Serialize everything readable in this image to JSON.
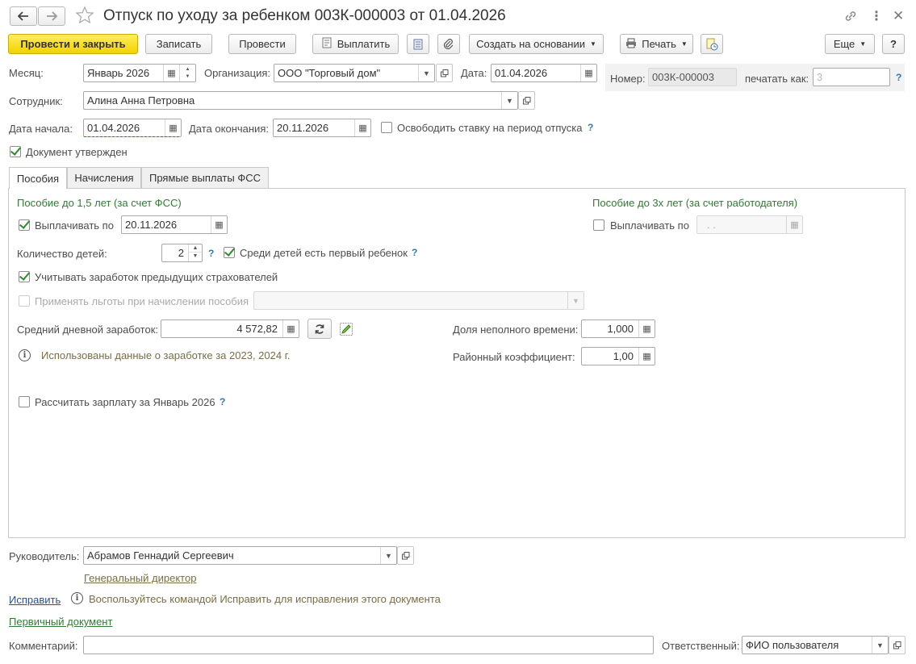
{
  "title": "Отпуск по уходу за ребенком 003К-000003 от 01.04.2026",
  "toolbar": {
    "post_close": "Провести и закрыть",
    "save": "Записать",
    "post": "Провести",
    "pay": "Выплатить",
    "create_based": "Создать на основании",
    "print": "Печать",
    "more": "Еще",
    "help": "?"
  },
  "header": {
    "month_label": "Месяц:",
    "month_value": "Январь 2026",
    "org_label": "Организация:",
    "org_value": "ООО \"Торговый дом\"",
    "date_label": "Дата:",
    "date_value": "01.04.2026",
    "number_label": "Номер:",
    "number_value": "003К-000003",
    "print_as_label": "печатать как:",
    "print_as_value": "3",
    "employee_label": "Сотрудник:",
    "employee_value": "Алина Анна Петровна",
    "start_label": "Дата начала:",
    "start_value": "01.04.2026",
    "end_label": "Дата окончания:",
    "end_value": "20.11.2026",
    "release_rate_label": "Освободить ставку на период отпуска",
    "approved_label": "Документ утвержден"
  },
  "tabs": [
    "Пособия",
    "Начисления",
    "Прямые выплаты ФСС"
  ],
  "benefits": {
    "section1_title": "Пособие до 1,5 лет (за счет ФСС)",
    "section2_title": "Пособие до 3х лет (за счет работодателя)",
    "pay_until_label": "Выплачивать по",
    "pay_until_value": "20.11.2026",
    "pay_until2_label": "Выплачивать по",
    "pay_until2_value": " .  .",
    "children_label": "Количество детей:",
    "children_value": "2",
    "first_child_label": "Среди детей есть первый ребенок",
    "prev_insurers_label": "Учитывать заработок предыдущих страхователей",
    "privileges_label": "Применять льготы при начислении пособия",
    "avg_earnings_label": "Средний дневной заработок:",
    "avg_earnings_value": "4 572,82",
    "parttime_label": "Доля неполного времени:",
    "parttime_value": "1,000",
    "regional_label": "Районный коэффициент:",
    "regional_value": "1,00",
    "info_text": "Использованы данные о заработке за  2023,  2024 г.",
    "calc_salary_label": "Рассчитать зарплату за Январь 2026"
  },
  "footer": {
    "manager_label": "Руководитель:",
    "manager_value": "Абрамов Геннадий Сергеевич",
    "manager_position": "Генеральный директор",
    "fix_link": "Исправить",
    "fix_hint": "Воспользуйтесь командой Исправить для исправления этого документа",
    "primary_doc_link": "Первичный документ",
    "comment_label": "Комментарий:",
    "comment_value": "",
    "responsible_label": "Ответственный:",
    "responsible_value": "ФИО пользователя"
  },
  "colors": {
    "primary_button": "#f3d200",
    "section_title": "#2e7d32",
    "info_text": "#7a6d45",
    "link": "#2c4e9a",
    "checkmark": "#2f8a2f"
  }
}
